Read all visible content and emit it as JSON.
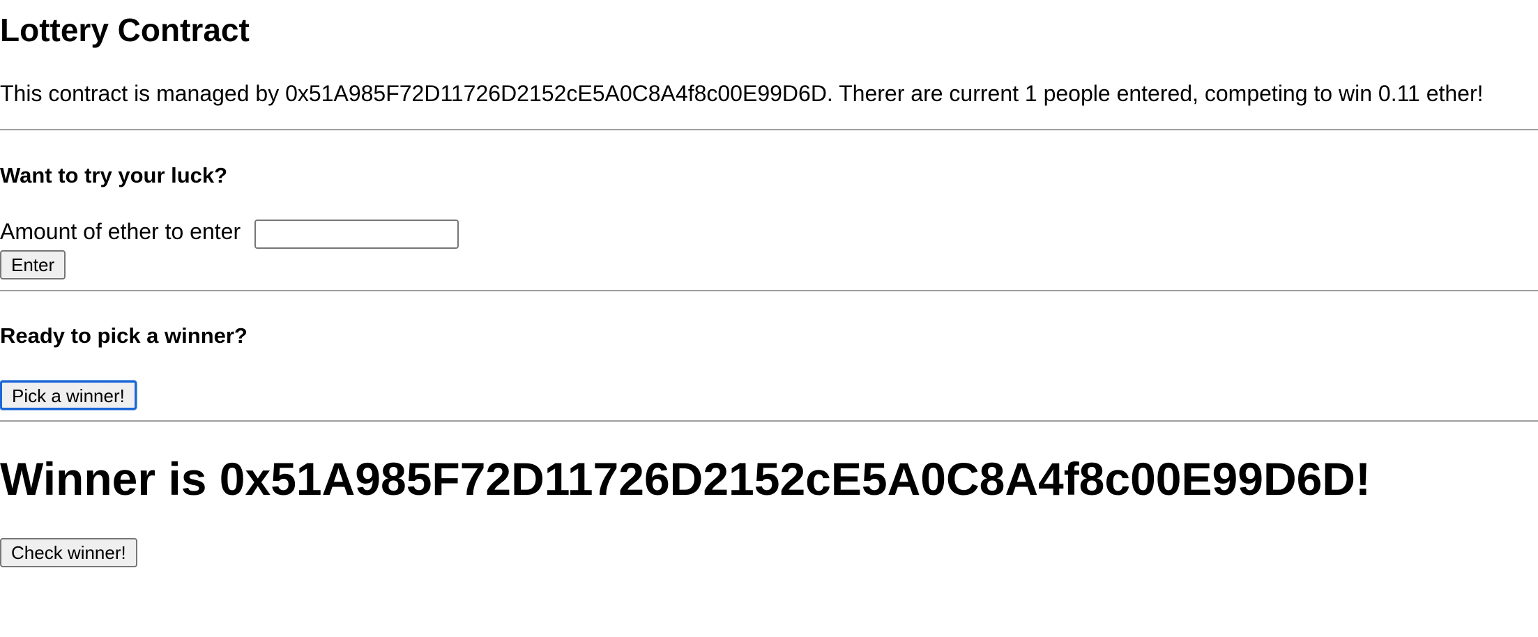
{
  "page": {
    "title": "Lottery Contract",
    "intro": "This contract is managed by 0x51A985F72D11726D2152cE5A0C8A4f8c00E99D6D. Therer are current 1 people entered, competing to win 0.11 ether!"
  },
  "enter_section": {
    "heading": "Want to try your luck?",
    "amount_label": "Amount of ether to enter",
    "amount_value": "",
    "enter_button": "Enter"
  },
  "pick_section": {
    "heading": "Ready to pick a winner?",
    "pick_button": "Pick a winner!"
  },
  "winner_section": {
    "message": "Winner is 0x51A985F72D11726D2152cE5A0C8A4f8c00E99D6D!",
    "check_button": "Check winner!"
  },
  "colors": {
    "divider": "#9e9e9e",
    "button_bg": "#efefef",
    "focus_ring": "#1a66d6"
  }
}
